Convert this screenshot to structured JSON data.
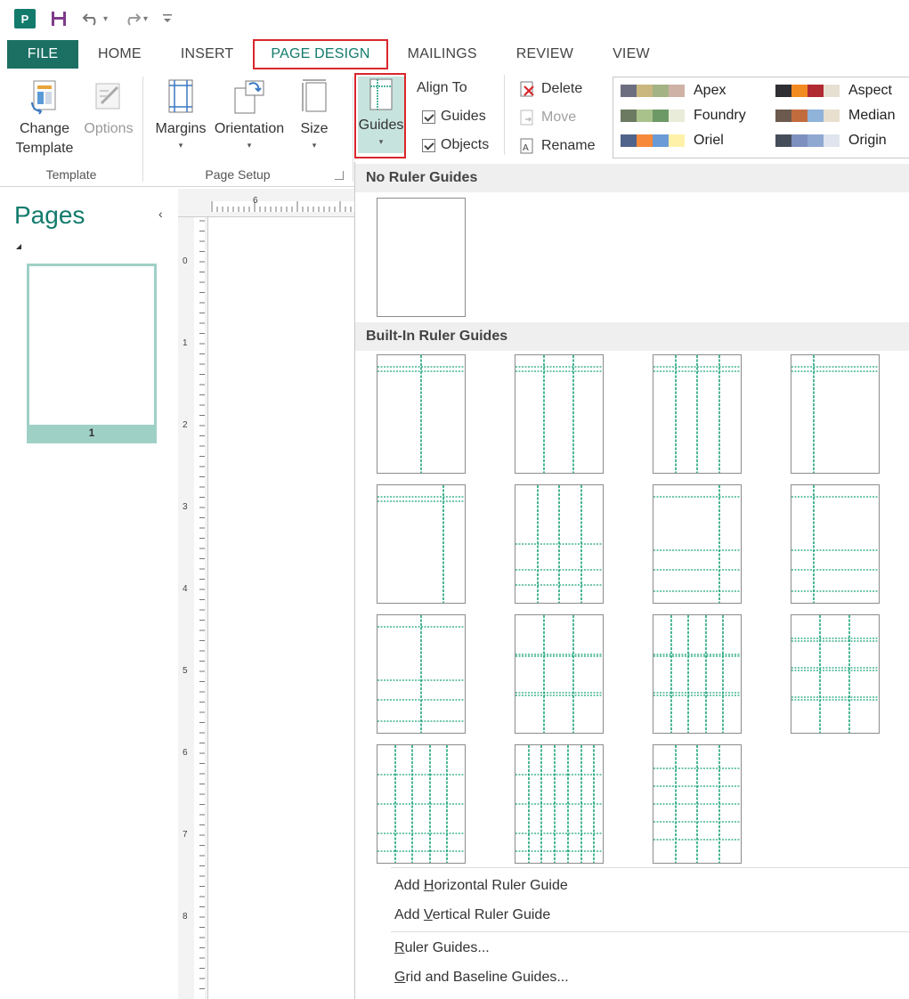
{
  "quick_access": {
    "app_icon": "P",
    "icons": [
      "publisher-logo-icon",
      "save-icon",
      "undo-icon",
      "redo-icon",
      "customize-qat-icon"
    ]
  },
  "tabs": [
    {
      "label": "FILE",
      "name": "tab-file"
    },
    {
      "label": "HOME",
      "name": "tab-home"
    },
    {
      "label": "INSERT",
      "name": "tab-insert"
    },
    {
      "label": "PAGE DESIGN",
      "name": "tab-page-design",
      "active": true
    },
    {
      "label": "MAILINGS",
      "name": "tab-mailings"
    },
    {
      "label": "REVIEW",
      "name": "tab-review"
    },
    {
      "label": "VIEW",
      "name": "tab-view"
    }
  ],
  "ribbon": {
    "template": {
      "label": "Template",
      "change_line1": "Change",
      "change_line2": "Template",
      "options": "Options"
    },
    "page_setup": {
      "label": "Page Setup",
      "margins": "Margins",
      "orientation": "Orientation",
      "size": "Size"
    },
    "layout": {
      "guides": "Guides",
      "align_to": "Align To",
      "align_guides": "Guides",
      "align_objects": "Objects",
      "delete": "Delete",
      "move": "Move",
      "rename": "Rename"
    },
    "schemes": [
      {
        "name": "Apex",
        "colors": [
          "#6d6f80",
          "#c9b77f",
          "#a3b384",
          "#ceb2a5"
        ]
      },
      {
        "name": "Aspect",
        "colors": [
          "#2f2f33",
          "#f28a22",
          "#b02a31",
          "#e6e0d2"
        ]
      },
      {
        "name": "Foundry",
        "colors": [
          "#6c7a61",
          "#a9c28c",
          "#6d9966",
          "#e9ecd9"
        ]
      },
      {
        "name": "Median",
        "colors": [
          "#6b5a4d",
          "#c26c3e",
          "#8fb3d9",
          "#e8dfcf"
        ]
      },
      {
        "name": "Oriel",
        "colors": [
          "#50638a",
          "#f7893a",
          "#6b9bd6",
          "#fff1a8"
        ]
      },
      {
        "name": "Origin",
        "colors": [
          "#464d5a",
          "#7d8fbf",
          "#8ea8d1",
          "#dfe4ee"
        ]
      }
    ]
  },
  "pages_pane": {
    "title": "Pages",
    "collapse_glyph": "‹",
    "page_number": "1"
  },
  "rulers": {
    "h_mark": "6",
    "v_marks": [
      "0",
      "1",
      "2",
      "3",
      "4",
      "5",
      "6",
      "7",
      "8"
    ]
  },
  "dropdown": {
    "no_guides_header": "No Ruler Guides",
    "builtin_header": "Built-In Ruler Guides",
    "menu": {
      "add_horizontal_pre": "Add ",
      "add_horizontal_key": "H",
      "add_horizontal_post": "orizontal Ruler Guide",
      "add_vertical_pre": "Add ",
      "add_vertical_key": "V",
      "add_vertical_post": "ertical Ruler Guide",
      "ruler_guides_key": "R",
      "ruler_guides_post": "uler Guides...",
      "grid_key": "G",
      "grid_post": "rid and Baseline Guides..."
    }
  }
}
